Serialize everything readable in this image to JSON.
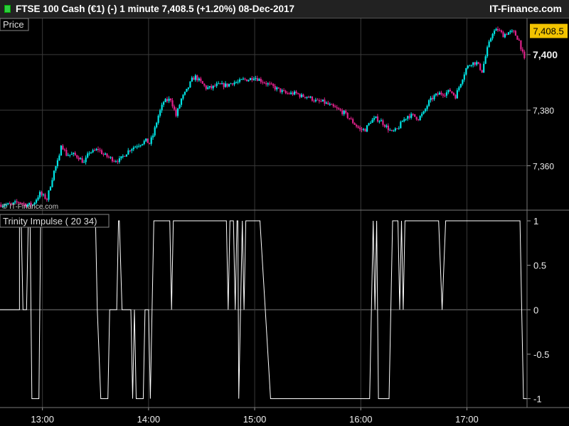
{
  "header": {
    "title": "FTSE 100 Cash (€1) (-)   1 minute   7,408.5 (+1.20%)   08-Dec-2017",
    "brand": "IT-Finance.com"
  },
  "colors": {
    "background": "#000000",
    "grid": "#3a3a3a",
    "up_candle": "#00e5e5",
    "down_candle": "#e0218a",
    "price_tag": "#f2c300",
    "indicator_line": "#ffffff"
  },
  "chart_data": [
    {
      "type": "candlestick",
      "panel_label": "Price",
      "watermark": "© IT-Finance.com",
      "last_price_label": "7,408.5",
      "last_price": 7408.5,
      "y_ticks": [
        7360,
        7380,
        7400
      ],
      "y_tick_labels": [
        "7,360",
        "7,380",
        "7,400"
      ],
      "ylim": [
        7344,
        7413
      ],
      "x_tick_labels": [
        "13:00",
        "14:00",
        "15:00",
        "16:00",
        "17:00"
      ],
      "x_tick_minutes": [
        780,
        840,
        900,
        960,
        1020
      ],
      "xlim_minutes": [
        756,
        1054
      ],
      "close_path": [
        [
          756,
          7346
        ],
        [
          762,
          7346
        ],
        [
          766,
          7347
        ],
        [
          770,
          7346
        ],
        [
          774,
          7346
        ],
        [
          778,
          7350
        ],
        [
          782,
          7348
        ],
        [
          786,
          7358
        ],
        [
          789,
          7363
        ],
        [
          790,
          7368
        ],
        [
          793,
          7364
        ],
        [
          797,
          7364
        ],
        [
          800,
          7363
        ],
        [
          803,
          7361
        ],
        [
          806,
          7365
        ],
        [
          808,
          7365
        ],
        [
          811,
          7366
        ],
        [
          814,
          7364
        ],
        [
          817,
          7363
        ],
        [
          820,
          7362
        ],
        [
          823,
          7362
        ],
        [
          826,
          7364
        ],
        [
          829,
          7366
        ],
        [
          832,
          7367
        ],
        [
          835,
          7368
        ],
        [
          838,
          7369
        ],
        [
          840,
          7368
        ],
        [
          842,
          7371
        ],
        [
          845,
          7378
        ],
        [
          848,
          7383
        ],
        [
          852,
          7384
        ],
        [
          855,
          7378
        ],
        [
          858,
          7384
        ],
        [
          861,
          7387
        ],
        [
          864,
          7391
        ],
        [
          866,
          7392
        ],
        [
          869,
          7390
        ],
        [
          872,
          7388
        ],
        [
          875,
          7388
        ],
        [
          878,
          7389
        ],
        [
          881,
          7389
        ],
        [
          884,
          7389
        ],
        [
          887,
          7390
        ],
        [
          890,
          7390
        ],
        [
          893,
          7391
        ],
        [
          896,
          7391
        ],
        [
          899,
          7392
        ],
        [
          902,
          7391
        ],
        [
          905,
          7390
        ],
        [
          908,
          7389
        ],
        [
          911,
          7388
        ],
        [
          914,
          7387
        ],
        [
          917,
          7386
        ],
        [
          920,
          7386
        ],
        [
          923,
          7386
        ],
        [
          926,
          7385
        ],
        [
          929,
          7385
        ],
        [
          932,
          7384
        ],
        [
          935,
          7383
        ],
        [
          938,
          7383
        ],
        [
          941,
          7382
        ],
        [
          944,
          7381
        ],
        [
          947,
          7380
        ],
        [
          950,
          7379
        ],
        [
          953,
          7377
        ],
        [
          956,
          7375
        ],
        [
          959,
          7373
        ],
        [
          962,
          7373
        ],
        [
          965,
          7376
        ],
        [
          968,
          7377
        ],
        [
          971,
          7376
        ],
        [
          974,
          7374
        ],
        [
          977,
          7372
        ],
        [
          980,
          7373
        ],
        [
          983,
          7376
        ],
        [
          986,
          7378
        ],
        [
          989,
          7378
        ],
        [
          992,
          7377
        ],
        [
          995,
          7379
        ],
        [
          998,
          7383
        ],
        [
          1001,
          7385
        ],
        [
          1004,
          7386
        ],
        [
          1007,
          7386
        ],
        [
          1010,
          7387
        ],
        [
          1013,
          7385
        ],
        [
          1016,
          7390
        ],
        [
          1019,
          7395
        ],
        [
          1022,
          7397
        ],
        [
          1025,
          7397
        ],
        [
          1028,
          7394
        ],
        [
          1031,
          7402
        ],
        [
          1034,
          7408
        ],
        [
          1037,
          7409
        ],
        [
          1040,
          7407
        ],
        [
          1043,
          7408
        ],
        [
          1046,
          7408
        ],
        [
          1049,
          7405
        ],
        [
          1052,
          7398
        ]
      ]
    },
    {
      "type": "line",
      "panel_label": "Trinity Impulse ( 20 34)",
      "y_ticks": [
        -1,
        -0.5,
        0,
        0.5,
        1
      ],
      "y_tick_labels": [
        "-1",
        "-0.5",
        "0",
        "0.5",
        "1"
      ],
      "ylim": [
        -1.1,
        1.12
      ],
      "x_tick_labels": [
        "13:00",
        "14:00",
        "15:00",
        "16:00",
        "17:00"
      ],
      "x_tick_minutes": [
        780,
        840,
        900,
        960,
        1020
      ],
      "xlim_minutes": [
        756,
        1054
      ],
      "step_series": [
        [
          756,
          0
        ],
        [
          767,
          0
        ],
        [
          767,
          1
        ],
        [
          768,
          1
        ],
        [
          769,
          0
        ],
        [
          771,
          0
        ],
        [
          772,
          1
        ],
        [
          773,
          1
        ],
        [
          774,
          -1
        ],
        [
          778,
          -1
        ],
        [
          779,
          1
        ],
        [
          780,
          1
        ],
        [
          795,
          1
        ],
        [
          796,
          1
        ],
        [
          798,
          1
        ],
        [
          810,
          1
        ],
        [
          811,
          0
        ],
        [
          813,
          -1
        ],
        [
          817,
          -1
        ],
        [
          818,
          0
        ],
        [
          822,
          0
        ],
        [
          823,
          1
        ],
        [
          823.5,
          1
        ],
        [
          825,
          0
        ],
        [
          830,
          0
        ],
        [
          831,
          -1
        ],
        [
          832,
          0
        ],
        [
          833,
          -1
        ],
        [
          837,
          -1
        ],
        [
          838,
          0
        ],
        [
          840,
          0
        ],
        [
          841,
          -1
        ],
        [
          842,
          0
        ],
        [
          843,
          1
        ],
        [
          844,
          1
        ],
        [
          852,
          1
        ],
        [
          853,
          0
        ],
        [
          854,
          1
        ],
        [
          884,
          1
        ],
        [
          885,
          0
        ],
        [
          886,
          1
        ],
        [
          888,
          1
        ],
        [
          889,
          0
        ],
        [
          890,
          1
        ],
        [
          890.5,
          1
        ],
        [
          891,
          -1
        ],
        [
          892,
          0
        ],
        [
          893,
          1
        ],
        [
          894,
          0
        ],
        [
          895,
          1
        ],
        [
          903,
          1
        ],
        [
          906,
          0
        ],
        [
          909,
          -1
        ],
        [
          965,
          -1
        ],
        [
          966,
          0
        ],
        [
          967,
          1
        ],
        [
          968,
          0
        ],
        [
          969,
          1
        ],
        [
          970,
          -1
        ],
        [
          976,
          -1
        ],
        [
          977,
          0
        ],
        [
          978,
          1
        ],
        [
          981,
          1
        ],
        [
          982,
          0
        ],
        [
          983,
          1
        ],
        [
          984,
          0
        ],
        [
          985,
          1
        ],
        [
          1004,
          1
        ],
        [
          1006,
          0
        ],
        [
          1008,
          1
        ],
        [
          1050,
          1
        ],
        [
          1051,
          0
        ],
        [
          1052,
          -1
        ],
        [
          1054,
          -1
        ]
      ]
    }
  ]
}
